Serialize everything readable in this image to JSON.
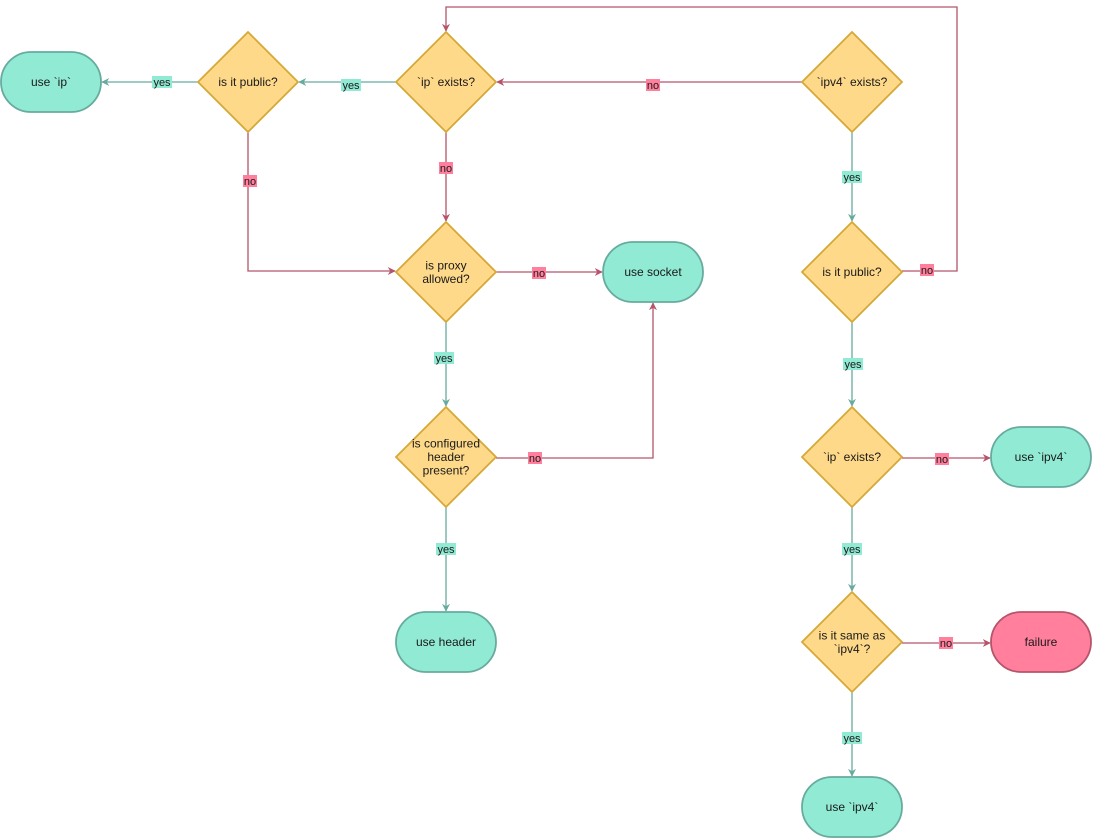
{
  "diagram": {
    "type": "flowchart",
    "colors": {
      "decision_fill": "#FFD98A",
      "decision_stroke": "#D6A838",
      "terminal_fill": "#91EAD4",
      "terminal_stroke": "#67AB9F",
      "failure_fill": "#FF7F9D",
      "failure_stroke": "#B5546A",
      "yes_edge": "#67AB9F",
      "no_edge": "#B5546A",
      "yes_label_bg": "#91EAD4",
      "no_label_bg": "#FF7F9D"
    },
    "nodes": [
      {
        "id": "use-ip",
        "kind": "terminal",
        "lines": [
          "use `ip`"
        ]
      },
      {
        "id": "is-public-left",
        "kind": "decision",
        "lines": [
          "is it public?"
        ]
      },
      {
        "id": "ip-exists-top",
        "kind": "decision",
        "lines": [
          "`ip` exists?"
        ]
      },
      {
        "id": "ipv4-exists",
        "kind": "decision",
        "lines": [
          "`ipv4` exists?"
        ]
      },
      {
        "id": "proxy-allowed",
        "kind": "decision",
        "lines": [
          "is proxy",
          "allowed?"
        ]
      },
      {
        "id": "use-socket",
        "kind": "terminal",
        "lines": [
          "use socket"
        ]
      },
      {
        "id": "header-present",
        "kind": "decision",
        "lines": [
          "is configured",
          "header",
          "present?"
        ]
      },
      {
        "id": "use-header",
        "kind": "terminal",
        "lines": [
          "use header"
        ]
      },
      {
        "id": "is-public-right",
        "kind": "decision",
        "lines": [
          "is it public?"
        ]
      },
      {
        "id": "ip-exists-right",
        "kind": "decision",
        "lines": [
          "`ip` exists?"
        ]
      },
      {
        "id": "use-ipv4-right",
        "kind": "terminal",
        "lines": [
          "use `ipv4`"
        ]
      },
      {
        "id": "same-as-ipv4",
        "kind": "decision",
        "lines": [
          "is it same as",
          "`ipv4`?"
        ]
      },
      {
        "id": "failure",
        "kind": "failure",
        "lines": [
          "failure"
        ]
      },
      {
        "id": "use-ipv4-bottom",
        "kind": "terminal",
        "lines": [
          "use `ipv4`"
        ]
      }
    ],
    "edges": [
      {
        "from": "is-public-left",
        "to": "use-ip",
        "label": "yes",
        "kind": "yes"
      },
      {
        "from": "ip-exists-top",
        "to": "is-public-left",
        "label": "yes",
        "kind": "yes"
      },
      {
        "from": "ipv4-exists",
        "to": "ip-exists-top",
        "label": "no",
        "kind": "no"
      },
      {
        "from": "is-public-left",
        "to": "proxy-allowed",
        "label": "no",
        "kind": "no"
      },
      {
        "from": "ip-exists-top",
        "to": "proxy-allowed",
        "label": "no",
        "kind": "no"
      },
      {
        "from": "proxy-allowed",
        "to": "use-socket",
        "label": "no",
        "kind": "no"
      },
      {
        "from": "proxy-allowed",
        "to": "header-present",
        "label": "yes",
        "kind": "yes"
      },
      {
        "from": "header-present",
        "to": "use-socket",
        "label": "no",
        "kind": "no"
      },
      {
        "from": "header-present",
        "to": "use-header",
        "label": "yes",
        "kind": "yes"
      },
      {
        "from": "ipv4-exists",
        "to": "is-public-right",
        "label": "yes",
        "kind": "yes"
      },
      {
        "from": "is-public-right",
        "to": "ip-exists-top",
        "label": "no",
        "kind": "no"
      },
      {
        "from": "is-public-right",
        "to": "ip-exists-right",
        "label": "yes",
        "kind": "yes"
      },
      {
        "from": "ip-exists-right",
        "to": "use-ipv4-right",
        "label": "no",
        "kind": "no"
      },
      {
        "from": "ip-exists-right",
        "to": "same-as-ipv4",
        "label": "yes",
        "kind": "yes"
      },
      {
        "from": "same-as-ipv4",
        "to": "failure",
        "label": "no",
        "kind": "no"
      },
      {
        "from": "same-as-ipv4",
        "to": "use-ipv4-bottom",
        "label": "yes",
        "kind": "yes"
      }
    ]
  }
}
